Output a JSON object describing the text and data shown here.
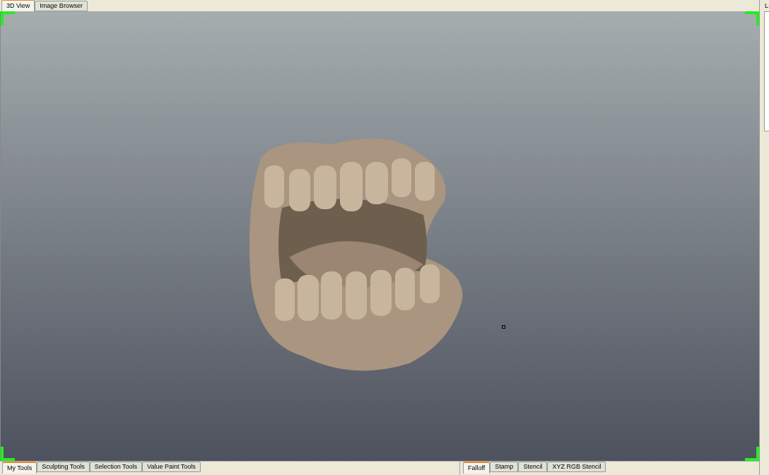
{
  "view_tabs": [
    {
      "label": "3D View",
      "selected": true
    },
    {
      "label": "Image Browser",
      "selected": false
    }
  ],
  "right_panel": {
    "title": "L"
  },
  "tool_tabs": [
    {
      "label": "My Tools",
      "selected": true
    },
    {
      "label": "Sculpting Tools",
      "selected": false
    },
    {
      "label": "Selection Tools",
      "selected": false
    },
    {
      "label": "Value Paint Tools",
      "selected": false
    }
  ],
  "brush_tabs": [
    {
      "label": "Falloff",
      "selected": true
    },
    {
      "label": "Stamp",
      "selected": false
    },
    {
      "label": "Stencil",
      "selected": false
    },
    {
      "label": "XYZ RGB Stencil",
      "selected": false
    }
  ]
}
